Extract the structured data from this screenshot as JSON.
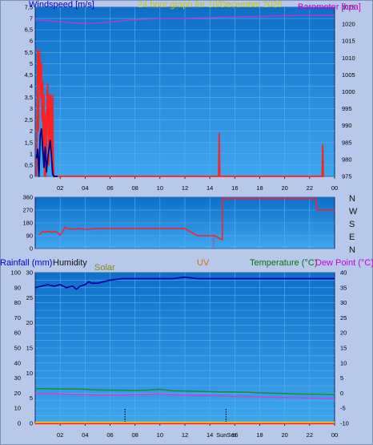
{
  "colors": {
    "background": "#b8c8ea",
    "plot_gradient_top": "#0d6fc8",
    "plot_gradient_bottom": "#3fa6ee",
    "grid": "#5fb0f0",
    "wind_speed": "#ff2020",
    "wind_gust": "#00008b",
    "barometer": "#cc33cc",
    "wind_direction": "#ff2020",
    "rain": "#ff2020",
    "humidity": "#0000aa",
    "solar": "#ffcc00",
    "uv": "#ff8800",
    "temperature": "#1a8a2a",
    "dew_point": "#cc44cc",
    "label_blue": "#0000cc",
    "label_magenta": "#cc00cc",
    "label_yellow": "#c8c800",
    "label_olive": "#8a8a00",
    "label_orange": "#cc7a00",
    "label_green": "#007700",
    "label_dark": "#111111"
  },
  "chart_data": [
    {
      "id": "wind-baro",
      "type": "line",
      "title": "24 hour graph for 10/December 2025",
      "left_label": "Windspeed [m/s]",
      "right_label": "Barometer [hpa]",
      "x_ticks": [
        "02",
        "04",
        "06",
        "08",
        "10",
        "12",
        "14",
        "16",
        "18",
        "20",
        "22",
        "00"
      ],
      "left_ticks": [
        "0",
        "0,5",
        "1",
        "1,5",
        "2",
        "2,5",
        "3",
        "3,5",
        "4",
        "4,5",
        "5",
        "5,5",
        "6",
        "6,5",
        "7",
        "7,5"
      ],
      "right_ticks": [
        "975",
        "980",
        "985",
        "990",
        "995",
        "1000",
        "1005",
        "1010",
        "1015",
        "1020",
        "1025"
      ],
      "left_ylim": [
        0,
        7.5
      ],
      "right_ylim": [
        975,
        1025
      ],
      "x_range_hours": [
        0,
        24
      ],
      "series": [
        {
          "key": "wind_speed",
          "axis": "left",
          "x": [
            0.1,
            0.2,
            0.25,
            0.3,
            0.35,
            0.4,
            0.45,
            0.5,
            0.55,
            0.6,
            0.65,
            0.7,
            0.75,
            0.8,
            0.85,
            0.9,
            0.95,
            1.0,
            1.05,
            1.1,
            1.15,
            1.2,
            1.25,
            1.3,
            1.35,
            1.4,
            1.45,
            1.5,
            1.55,
            1.6,
            1.65,
            1.7,
            1.75,
            1.8,
            1.85,
            1.9,
            14.7,
            14.75,
            14.8,
            23.0,
            23.05,
            23.1,
            23.15
          ],
          "y": [
            0,
            5.6,
            2,
            4.9,
            5.6,
            4.8,
            3.5,
            5,
            2.5,
            4.2,
            1,
            3.6,
            0,
            2.8,
            0,
            1.3,
            3.6,
            4.1,
            2,
            0.5,
            3.6,
            1.2,
            3.6,
            2.4,
            0.3,
            3.6,
            0.8,
            0,
            0,
            0,
            0,
            0,
            0,
            0,
            0,
            0,
            0,
            1.9,
            0,
            0,
            1.4,
            0,
            0
          ]
        },
        {
          "key": "wind_gust",
          "axis": "left",
          "x": [
            0.1,
            0.2,
            0.3,
            0.4,
            0.5,
            0.6,
            0.7,
            0.8,
            0.9,
            1.0,
            1.1,
            1.2,
            1.3,
            1.4,
            1.5,
            1.6,
            1.7,
            1.8
          ],
          "y": [
            0.8,
            1.2,
            0,
            1.8,
            2.1,
            1.2,
            0.4,
            1.3,
            0.2,
            0.8,
            1.2,
            1.6,
            0.9,
            0.1,
            0,
            0,
            0,
            0
          ]
        },
        {
          "key": "barometer",
          "axis": "right",
          "x": [
            0,
            1,
            2,
            3,
            4,
            5,
            6,
            7,
            8,
            9,
            10,
            12,
            14,
            16,
            18,
            20,
            22,
            24
          ],
          "y": [
            1021.2,
            1021,
            1020.7,
            1020.4,
            1020.2,
            1020.3,
            1020.6,
            1021,
            1021.3,
            1021.5,
            1021.6,
            1021.7,
            1021.9,
            1022.1,
            1022.3,
            1022.5,
            1022.6,
            1022.6
          ]
        }
      ]
    },
    {
      "id": "wind-direction",
      "type": "line",
      "left_ticks": [
        "0",
        "90",
        "180",
        "270",
        "360"
      ],
      "right_ticks": [
        "N",
        "E",
        "S",
        "W",
        "N"
      ],
      "x_ticks": [],
      "ylim": [
        0,
        360
      ],
      "x_range_hours": [
        0,
        24
      ],
      "series": [
        {
          "key": "wind_direction",
          "axis": "left",
          "x": [
            0.3,
            0.6,
            0.8,
            1.0,
            1.2,
            1.4,
            1.6,
            1.8,
            2.0,
            2.2,
            2.4,
            2.6,
            3.0,
            3.5,
            4,
            5,
            6,
            7,
            8,
            9,
            10,
            11,
            11.5,
            12,
            13,
            14,
            14.2,
            14.4,
            15,
            15.01,
            22.5,
            22.6,
            24
          ],
          "y": [
            95,
            120,
            115,
            120,
            118,
            115,
            120,
            110,
            95,
            120,
            150,
            140,
            135,
            140,
            135,
            140,
            140,
            140,
            140,
            140,
            140,
            140,
            140,
            140,
            90,
            90,
            90,
            90,
            60,
            350,
            350,
            270,
            270
          ]
        }
      ]
    },
    {
      "id": "rain-hum-temp",
      "type": "line",
      "labels": {
        "rainfall": "Rainfall (mm)",
        "humidity": "Humidity",
        "solar": "Solar",
        "uv": "UV",
        "temperature": "Temperature (°C)",
        "dew_point": "Dew Point (°C)",
        "sunset": "SunSet"
      },
      "left_ticks": [
        "0",
        "10",
        "20",
        "30",
        "40",
        "50",
        "60",
        "70",
        "80",
        "90",
        "100"
      ],
      "left2_ticks": [
        "0",
        "5",
        "10",
        "15",
        "20",
        "25",
        "30"
      ],
      "right_ticks": [
        "-10",
        "-5",
        "0",
        "5",
        "10",
        "15",
        "20",
        "25",
        "30",
        "35",
        "40"
      ],
      "x_ticks": [
        "02",
        "04",
        "06",
        "08",
        "10",
        "12",
        "14",
        "16",
        "18",
        "20",
        "22",
        "00"
      ],
      "ylim_humidity": [
        0,
        100
      ],
      "ylim_temp": [
        -10,
        40
      ],
      "x_range_hours": [
        0,
        24
      ],
      "sunrise_hour": 7.2,
      "sunset_hour": 15.3,
      "series": [
        {
          "key": "humidity",
          "axis": "left",
          "x": [
            0,
            0.5,
            1,
            1.5,
            2,
            2.5,
            3,
            3.3,
            3.6,
            4,
            4.3,
            4.5,
            5,
            5.5,
            6,
            7,
            8,
            9,
            10,
            11,
            12,
            13,
            14,
            15,
            16,
            17,
            18,
            19,
            20,
            21,
            22,
            23,
            24
          ],
          "y": [
            90,
            91,
            92,
            91,
            92,
            90,
            91,
            89,
            91,
            92,
            94,
            93,
            93,
            94,
            95,
            96,
            96,
            96,
            96,
            96,
            97,
            96,
            96,
            96,
            96,
            96,
            96,
            96,
            96,
            96,
            96,
            96,
            96
          ]
        },
        {
          "key": "temperature",
          "axis": "right",
          "x": [
            0,
            1,
            2,
            3,
            4,
            5,
            6,
            7,
            8,
            9,
            10,
            11,
            12,
            13,
            14,
            15,
            16,
            17,
            18,
            19,
            20,
            21,
            22,
            23,
            24
          ],
          "y": [
            1.5,
            1.5,
            1.4,
            1.4,
            1.3,
            1.1,
            1.0,
            1.0,
            0.9,
            1.0,
            1.3,
            0.8,
            0.7,
            0.6,
            0.5,
            0.4,
            0.4,
            0.3,
            0.1,
            0,
            -0.1,
            -0.2,
            -0.3,
            -0.3,
            -0.4
          ]
        },
        {
          "key": "dew_point",
          "axis": "right",
          "x": [
            0,
            1,
            2,
            3,
            4,
            5,
            6,
            7,
            8,
            9,
            10,
            11,
            12,
            13,
            14,
            15,
            16,
            17,
            18,
            19,
            20,
            21,
            22,
            23,
            24
          ],
          "y": [
            -0.1,
            -0.1,
            -0.2,
            -0.4,
            -0.5,
            -0.6,
            -0.6,
            -0.6,
            -0.5,
            -0.4,
            -0.2,
            -0.5,
            -0.7,
            -0.8,
            -0.8,
            -0.9,
            -1.0,
            -1.1,
            -1.2,
            -1.3,
            -1.4,
            -1.5,
            -1.6,
            -1.7,
            -1.9
          ]
        },
        {
          "key": "rain",
          "axis": "left",
          "x": [
            0,
            24
          ],
          "y": [
            0,
            0
          ]
        }
      ]
    }
  ]
}
